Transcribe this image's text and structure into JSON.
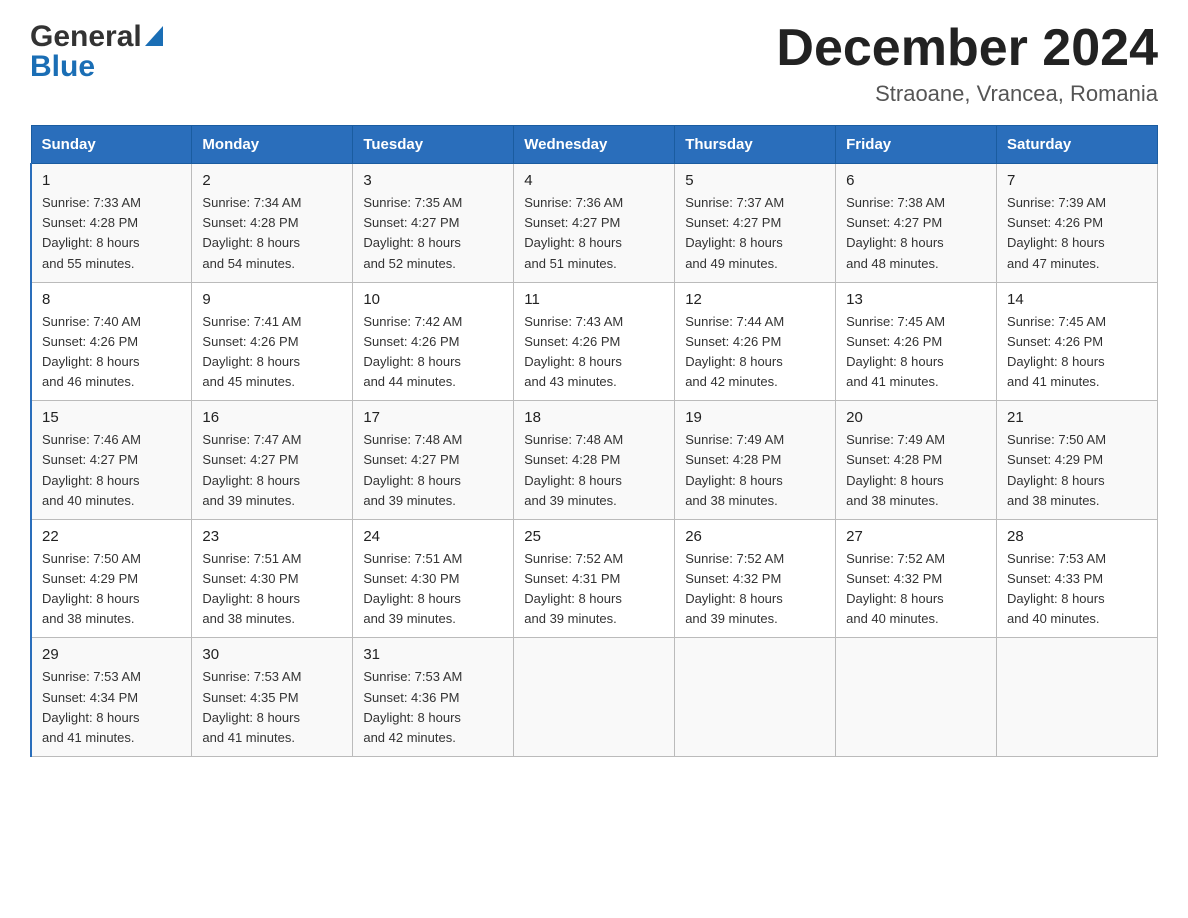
{
  "header": {
    "logo_general": "General",
    "logo_blue": "Blue",
    "month_title": "December 2024",
    "location": "Straoane, Vrancea, Romania"
  },
  "days_of_week": [
    "Sunday",
    "Monday",
    "Tuesday",
    "Wednesday",
    "Thursday",
    "Friday",
    "Saturday"
  ],
  "weeks": [
    [
      {
        "day": "1",
        "sunrise": "7:33 AM",
        "sunset": "4:28 PM",
        "daylight": "8 hours and 55 minutes."
      },
      {
        "day": "2",
        "sunrise": "7:34 AM",
        "sunset": "4:28 PM",
        "daylight": "8 hours and 54 minutes."
      },
      {
        "day": "3",
        "sunrise": "7:35 AM",
        "sunset": "4:27 PM",
        "daylight": "8 hours and 52 minutes."
      },
      {
        "day": "4",
        "sunrise": "7:36 AM",
        "sunset": "4:27 PM",
        "daylight": "8 hours and 51 minutes."
      },
      {
        "day": "5",
        "sunrise": "7:37 AM",
        "sunset": "4:27 PM",
        "daylight": "8 hours and 49 minutes."
      },
      {
        "day": "6",
        "sunrise": "7:38 AM",
        "sunset": "4:27 PM",
        "daylight": "8 hours and 48 minutes."
      },
      {
        "day": "7",
        "sunrise": "7:39 AM",
        "sunset": "4:26 PM",
        "daylight": "8 hours and 47 minutes."
      }
    ],
    [
      {
        "day": "8",
        "sunrise": "7:40 AM",
        "sunset": "4:26 PM",
        "daylight": "8 hours and 46 minutes."
      },
      {
        "day": "9",
        "sunrise": "7:41 AM",
        "sunset": "4:26 PM",
        "daylight": "8 hours and 45 minutes."
      },
      {
        "day": "10",
        "sunrise": "7:42 AM",
        "sunset": "4:26 PM",
        "daylight": "8 hours and 44 minutes."
      },
      {
        "day": "11",
        "sunrise": "7:43 AM",
        "sunset": "4:26 PM",
        "daylight": "8 hours and 43 minutes."
      },
      {
        "day": "12",
        "sunrise": "7:44 AM",
        "sunset": "4:26 PM",
        "daylight": "8 hours and 42 minutes."
      },
      {
        "day": "13",
        "sunrise": "7:45 AM",
        "sunset": "4:26 PM",
        "daylight": "8 hours and 41 minutes."
      },
      {
        "day": "14",
        "sunrise": "7:45 AM",
        "sunset": "4:26 PM",
        "daylight": "8 hours and 41 minutes."
      }
    ],
    [
      {
        "day": "15",
        "sunrise": "7:46 AM",
        "sunset": "4:27 PM",
        "daylight": "8 hours and 40 minutes."
      },
      {
        "day": "16",
        "sunrise": "7:47 AM",
        "sunset": "4:27 PM",
        "daylight": "8 hours and 39 minutes."
      },
      {
        "day": "17",
        "sunrise": "7:48 AM",
        "sunset": "4:27 PM",
        "daylight": "8 hours and 39 minutes."
      },
      {
        "day": "18",
        "sunrise": "7:48 AM",
        "sunset": "4:28 PM",
        "daylight": "8 hours and 39 minutes."
      },
      {
        "day": "19",
        "sunrise": "7:49 AM",
        "sunset": "4:28 PM",
        "daylight": "8 hours and 38 minutes."
      },
      {
        "day": "20",
        "sunrise": "7:49 AM",
        "sunset": "4:28 PM",
        "daylight": "8 hours and 38 minutes."
      },
      {
        "day": "21",
        "sunrise": "7:50 AM",
        "sunset": "4:29 PM",
        "daylight": "8 hours and 38 minutes."
      }
    ],
    [
      {
        "day": "22",
        "sunrise": "7:50 AM",
        "sunset": "4:29 PM",
        "daylight": "8 hours and 38 minutes."
      },
      {
        "day": "23",
        "sunrise": "7:51 AM",
        "sunset": "4:30 PM",
        "daylight": "8 hours and 38 minutes."
      },
      {
        "day": "24",
        "sunrise": "7:51 AM",
        "sunset": "4:30 PM",
        "daylight": "8 hours and 39 minutes."
      },
      {
        "day": "25",
        "sunrise": "7:52 AM",
        "sunset": "4:31 PM",
        "daylight": "8 hours and 39 minutes."
      },
      {
        "day": "26",
        "sunrise": "7:52 AM",
        "sunset": "4:32 PM",
        "daylight": "8 hours and 39 minutes."
      },
      {
        "day": "27",
        "sunrise": "7:52 AM",
        "sunset": "4:32 PM",
        "daylight": "8 hours and 40 minutes."
      },
      {
        "day": "28",
        "sunrise": "7:53 AM",
        "sunset": "4:33 PM",
        "daylight": "8 hours and 40 minutes."
      }
    ],
    [
      {
        "day": "29",
        "sunrise": "7:53 AM",
        "sunset": "4:34 PM",
        "daylight": "8 hours and 41 minutes."
      },
      {
        "day": "30",
        "sunrise": "7:53 AM",
        "sunset": "4:35 PM",
        "daylight": "8 hours and 41 minutes."
      },
      {
        "day": "31",
        "sunrise": "7:53 AM",
        "sunset": "4:36 PM",
        "daylight": "8 hours and 42 minutes."
      },
      null,
      null,
      null,
      null
    ]
  ],
  "labels": {
    "sunrise": "Sunrise:",
    "sunset": "Sunset:",
    "daylight": "Daylight:"
  }
}
